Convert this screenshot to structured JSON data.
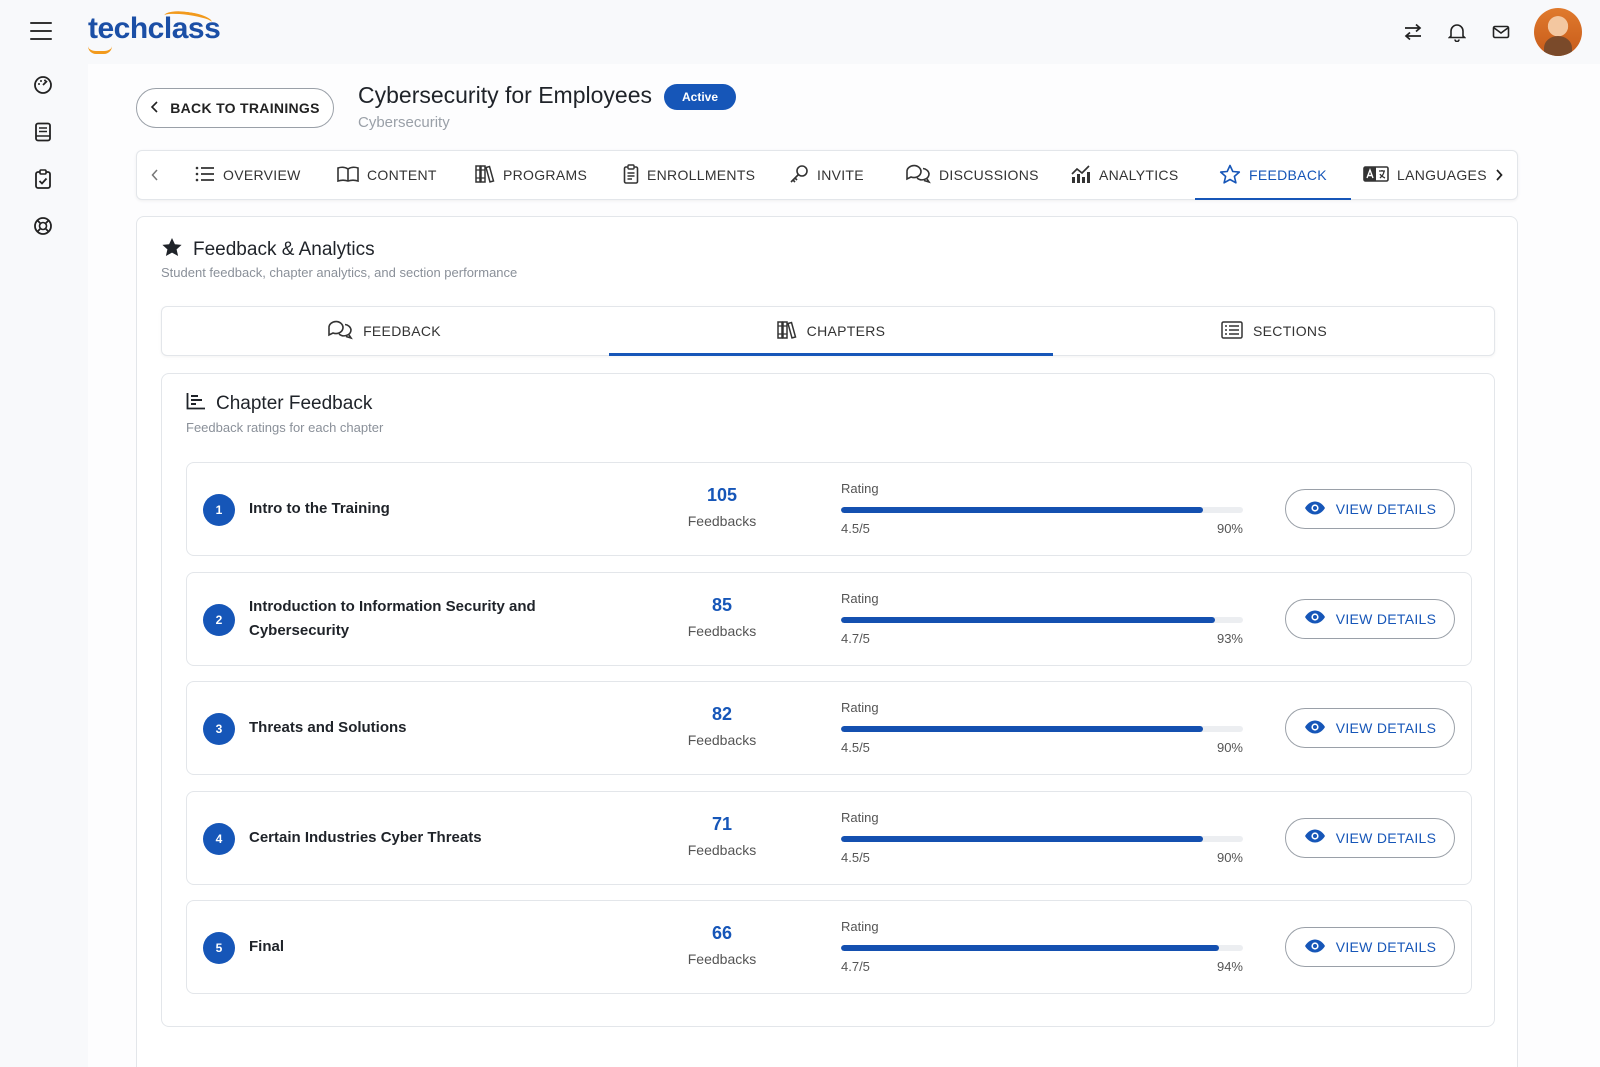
{
  "app": {
    "logo_text": "techclass"
  },
  "topbar": {
    "icons": [
      "swap-icon",
      "bell-icon",
      "mail-icon"
    ],
    "avatar_icon": "user-avatar"
  },
  "sidebar": {
    "icons": [
      "hamburger-icon",
      "dashboard-icon",
      "book-icon",
      "clipboard-check-icon",
      "lifebuoy-icon"
    ]
  },
  "header": {
    "back_label": "BACK TO TRAININGS",
    "title": "Cybersecurity for Employees",
    "status": "Active",
    "subtitle": "Cybersecurity"
  },
  "tabs": [
    {
      "label": "OVERVIEW",
      "icon": "list-icon"
    },
    {
      "label": "CONTENT",
      "icon": "open-book-icon"
    },
    {
      "label": "PROGRAMS",
      "icon": "books-icon"
    },
    {
      "label": "ENROLLMENTS",
      "icon": "clipboard-icon"
    },
    {
      "label": "INVITE",
      "icon": "key-icon"
    },
    {
      "label": "DISCUSSIONS",
      "icon": "chat-icon"
    },
    {
      "label": "ANALYTICS",
      "icon": "analytics-icon"
    },
    {
      "label": "FEEDBACK",
      "icon": "star-outline-icon",
      "active": true
    },
    {
      "label": "LANGUAGES",
      "icon": "language-icon"
    }
  ],
  "panel": {
    "title": "Feedback & Analytics",
    "subtitle": "Student feedback, chapter analytics, and section performance",
    "subtabs": [
      {
        "label": "FEEDBACK",
        "icon": "chat-icon"
      },
      {
        "label": "CHAPTERS",
        "icon": "books-icon",
        "active": true
      },
      {
        "label": "SECTIONS",
        "icon": "list-box-icon"
      }
    ]
  },
  "chapter_feedback": {
    "title": "Chapter Feedback",
    "subtitle": "Feedback ratings for each chapter",
    "rating_label": "Rating",
    "feedbacks_label": "Feedbacks",
    "view_label": "VIEW DETAILS",
    "chapters": [
      {
        "num": "1",
        "name": "Intro to the Training",
        "count": "105",
        "rating": "4.5/5",
        "pct": "90%",
        "fill": 0.9
      },
      {
        "num": "2",
        "name": "Introduction to Information Security and Cybersecurity",
        "count": "85",
        "rating": "4.7/5",
        "pct": "93%",
        "fill": 0.93
      },
      {
        "num": "3",
        "name": "Threats and Solutions",
        "count": "82",
        "rating": "4.5/5",
        "pct": "90%",
        "fill": 0.9
      },
      {
        "num": "4",
        "name": "Certain Industries Cyber Threats",
        "count": "71",
        "rating": "4.5/5",
        "pct": "90%",
        "fill": 0.9
      },
      {
        "num": "5",
        "name": "Final",
        "count": "66",
        "rating": "4.7/5",
        "pct": "94%",
        "fill": 0.94
      }
    ]
  },
  "colors": {
    "primary": "#1656b8",
    "accent": "#f29a1c"
  }
}
